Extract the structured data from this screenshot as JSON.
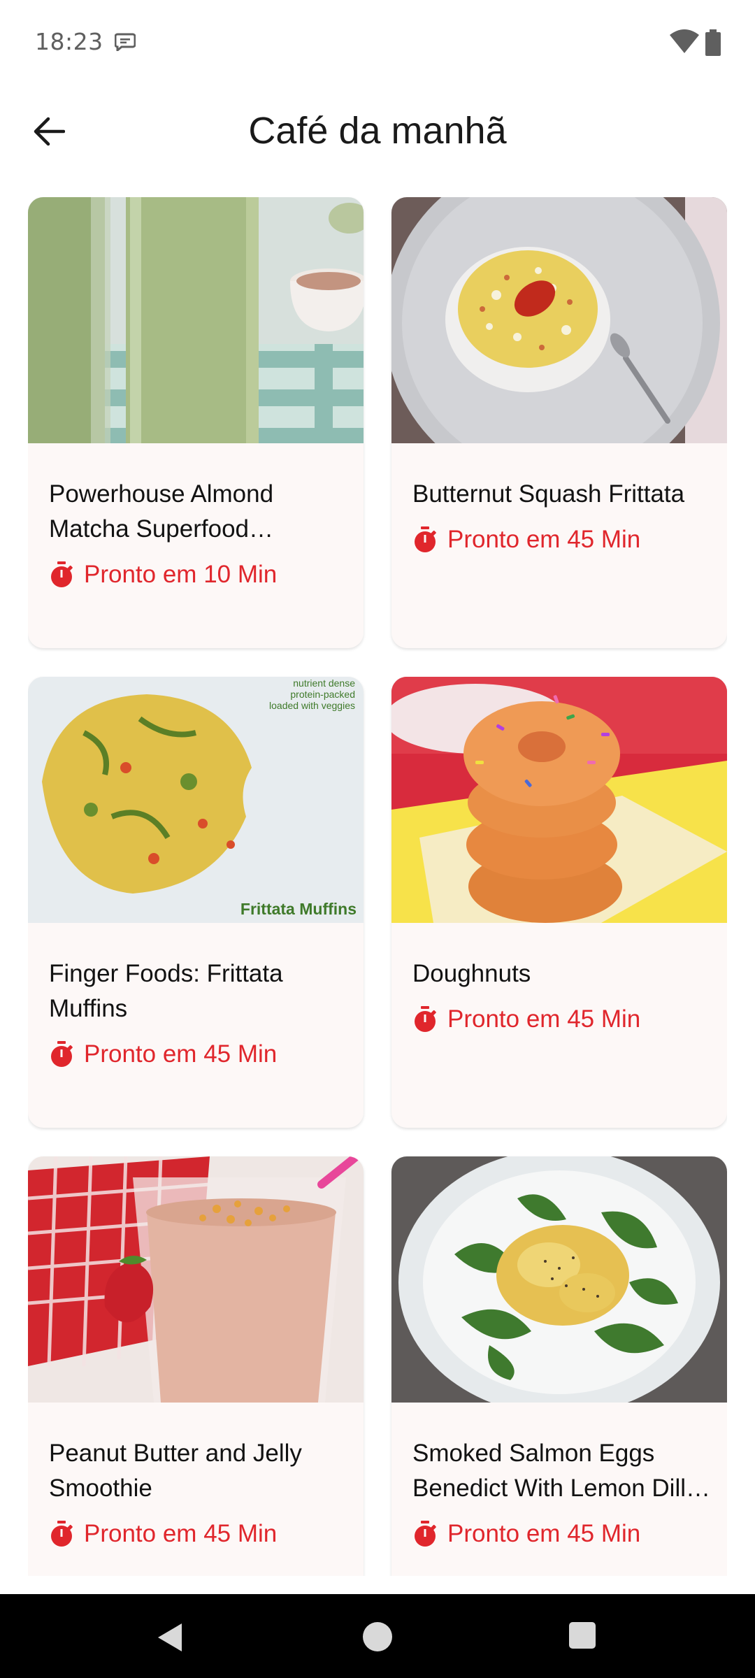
{
  "status_bar": {
    "time": "18:23",
    "icons": [
      "message-icon",
      "wifi-icon",
      "battery-icon"
    ]
  },
  "header": {
    "title": "Café da manhã",
    "back_icon": "arrow-back-icon"
  },
  "recipes": [
    {
      "title": "Powerhouse Almond Matcha Superfood Smoothie",
      "ready": "Pronto em 10 Min",
      "image": "green smoothie"
    },
    {
      "title": "Butternut Squash Frittata",
      "ready": "Pronto em 45 Min",
      "image": "frittata with tomato"
    },
    {
      "title": "Finger Foods: Frittata Muffins",
      "ready": "Pronto em 45 Min",
      "image": "frittata muffin"
    },
    {
      "title": "Doughnuts",
      "ready": "Pronto em 45 Min",
      "image": "stacked doughnuts"
    },
    {
      "title": "Peanut Butter and Jelly Smoothie",
      "ready": "Pronto em 45 Min",
      "image": "strawberry smoothie"
    },
    {
      "title": "Smoked Salmon Eggs Benedict With Lemon Dill Hollandaise",
      "ready": "Pronto em 45 Min",
      "image": "eggs benedict"
    }
  ],
  "image_text": {
    "muffin_caption": "Frittata Muffins",
    "muffin_tagline_1": "nutrient dense",
    "muffin_tagline_2": "protein-packed",
    "muffin_tagline_3": "loaded with veggies"
  },
  "colors": {
    "accent": "#e0262c",
    "card_background": "#fdf8f7",
    "nav_background": "#000000"
  },
  "nav_bar": {
    "icons": [
      "nav-back-icon",
      "nav-home-icon",
      "nav-recents-icon"
    ]
  }
}
